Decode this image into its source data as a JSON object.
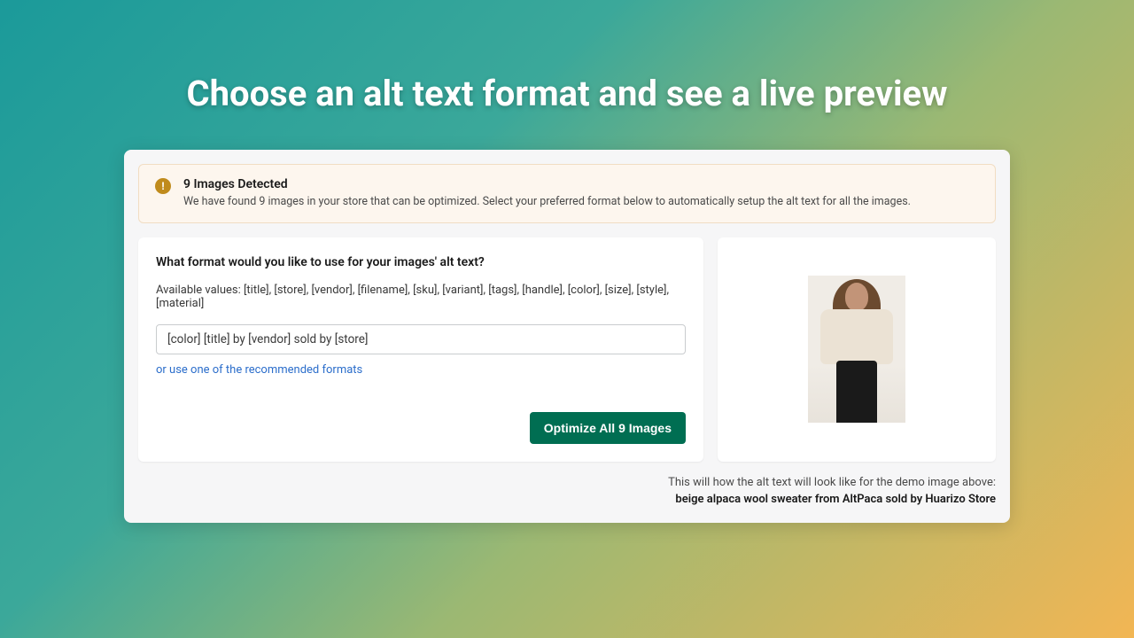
{
  "hero": {
    "title": "Choose an alt text format and see a live preview"
  },
  "alert": {
    "title": "9 Images Detected",
    "description": "We have found 9 images in your store that can be optimized. Select your preferred format below to automatically setup the alt text for all the images."
  },
  "format": {
    "question": "What format would you like to use for your images' alt text?",
    "available_label": "Available values: [title], [store], [vendor], [filename], [sku], [variant], [tags], [handle], [color], [size], [style], [material]",
    "input_value": "[color] [title] by [vendor] sold by [store]",
    "recommended_link": "or use one of the recommended formats",
    "optimize_button": "Optimize All 9 Images"
  },
  "preview": {
    "caption_intro": "This will how the alt text will look like for the demo image above:",
    "caption_result": "beige alpaca wool sweater from AltPaca sold by Huarizo Store"
  }
}
